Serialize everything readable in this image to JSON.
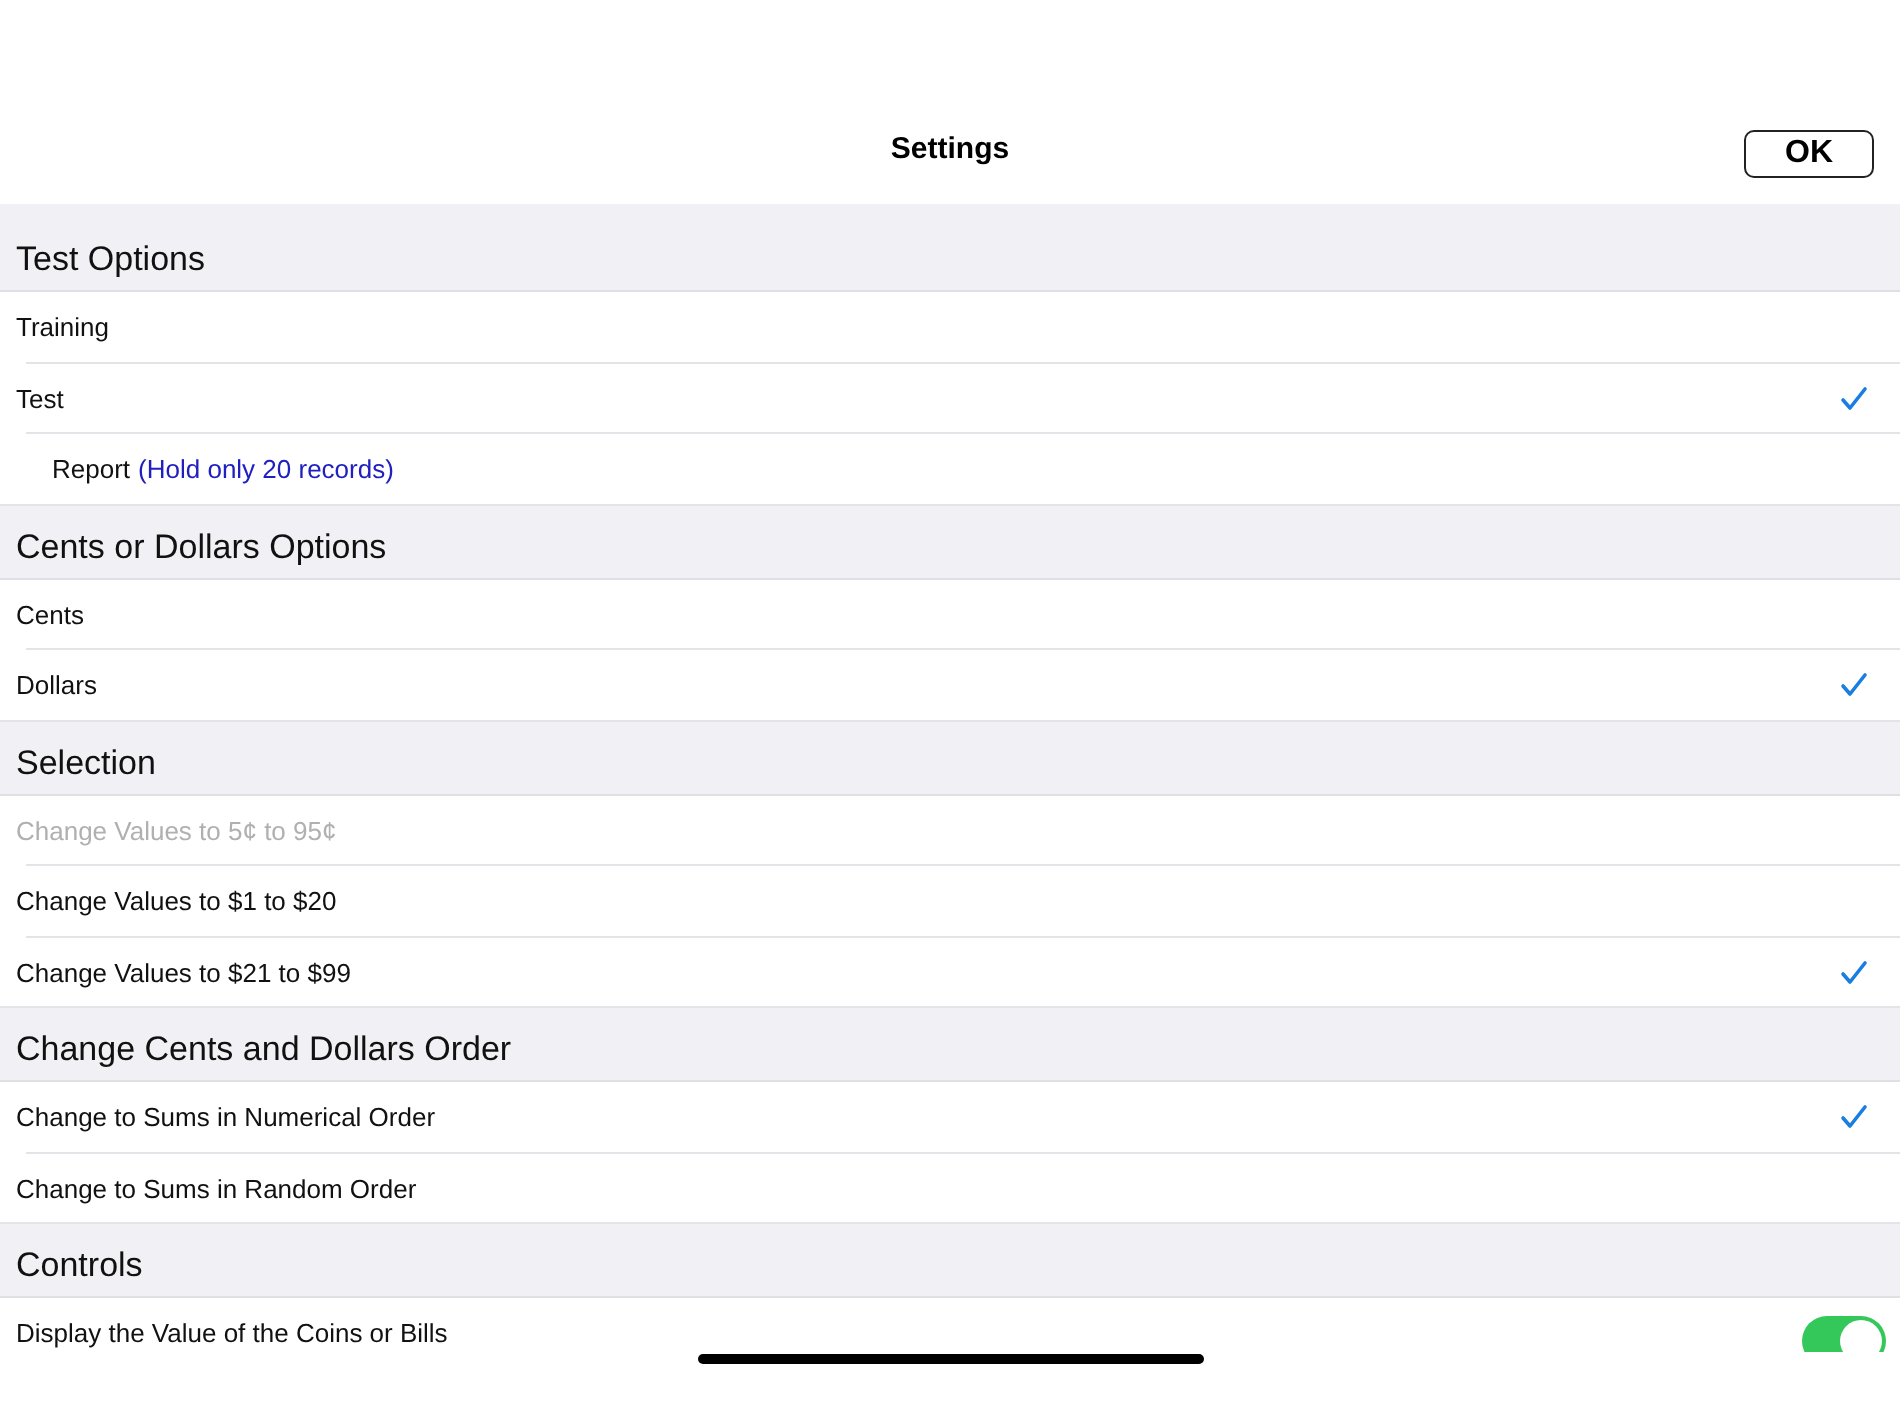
{
  "title": "Settings",
  "ok_button": "OK",
  "sections": [
    {
      "header": "Test Options",
      "rows": [
        {
          "kind": "check",
          "label": "Training",
          "checked": false
        },
        {
          "kind": "check",
          "label": "Test",
          "checked": true
        },
        {
          "kind": "report",
          "label": "Report",
          "note": "(Hold only 20 records)"
        }
      ]
    },
    {
      "header": "Cents or Dollars Options",
      "rows": [
        {
          "kind": "check",
          "label": "Cents",
          "checked": false
        },
        {
          "kind": "check",
          "label": "Dollars",
          "checked": true
        }
      ]
    },
    {
      "header": "Selection",
      "rows": [
        {
          "kind": "check",
          "label": "Change Values to 5¢ to 95¢",
          "checked": false,
          "disabled": true
        },
        {
          "kind": "check",
          "label": "Change Values to $1 to $20",
          "checked": false,
          "disabled": false
        },
        {
          "kind": "check",
          "label": "Change Values to $21 to $99",
          "checked": true,
          "disabled": false
        }
      ]
    },
    {
      "header": "Change Cents and Dollars Order",
      "rows": [
        {
          "kind": "check",
          "label": "Change to Sums in Numerical Order",
          "checked": true
        },
        {
          "kind": "check",
          "label": "Change to Sums in Random Order",
          "checked": false
        }
      ]
    },
    {
      "header": "Controls",
      "rows": [
        {
          "kind": "toggle",
          "label": "Display the Value of the Coins or Bills",
          "on": true
        }
      ]
    }
  ]
}
